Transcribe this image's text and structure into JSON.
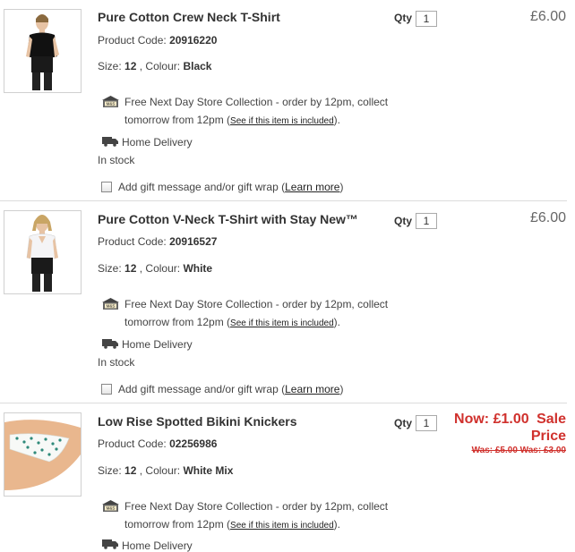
{
  "common": {
    "qty_label": "Qty",
    "store_line1": "Free Next Day Store Collection - order by 12pm, collect",
    "store_line2_prefix": "tomorrow from 12pm (",
    "store_link": "See if this item is included",
    "store_line2_suffix": ").",
    "home_delivery": "Home Delivery",
    "gift_label": "Add gift message and/or gift wrap (",
    "gift_link": "Learn more",
    "gift_suffix": ")",
    "size_label": "Size:",
    "colour_label": ", Colour:",
    "code_label": "Product Code:",
    "ms_badge": "M&S"
  },
  "items": [
    {
      "title": "Pure Cotton Crew Neck T-Shirt",
      "code": "20916220",
      "size": "12",
      "colour": "Black",
      "qty": "1",
      "price": "£6.00",
      "stock": "In stock"
    },
    {
      "title": "Pure Cotton V-Neck T-Shirt with Stay New™",
      "code": "20916527",
      "size": "12",
      "colour": "White",
      "qty": "1",
      "price": "£6.00",
      "stock": "In stock"
    },
    {
      "title": "Low Rise Spotted Bikini Knickers",
      "code": "02256986",
      "size": "12",
      "colour": "White Mix",
      "qty": "1",
      "now_price": "Now: £1.00",
      "sale_label_1": "Sale",
      "sale_label_2": "Price",
      "was_prices": "Was: £5.00 Was: £3.00"
    }
  ],
  "colors": {
    "sale_red": "#d0312d",
    "text": "#333333",
    "divider": "#dcdcdc"
  }
}
